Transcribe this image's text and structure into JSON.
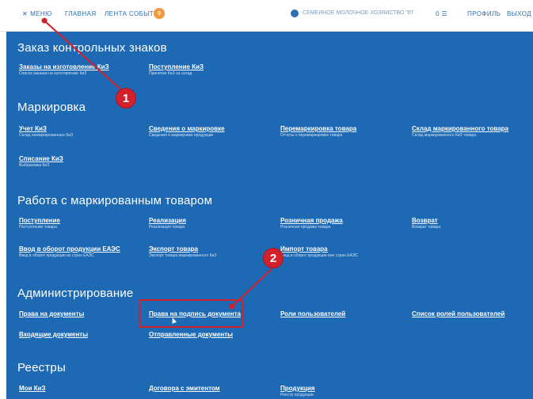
{
  "topbar": {
    "menu_icon": "close-icon",
    "menu_label": "МЕНЮ",
    "home_label": "ГЛАВНАЯ",
    "feed_label": "ЛЕНТА СОБЫТИЙ",
    "feed_badge": "0",
    "org_name": "СЕМЕЙНОЕ МОЛОЧНОЕ ХОЗЯЙСТВО \"ЕГЕНЬ\"",
    "count": "0",
    "profile_label": "ПРОФИЛЬ",
    "logout_label": "ВЫХОД"
  },
  "sections": {
    "order": {
      "title": "Заказ контрольных знаков",
      "items": [
        {
          "label": "Заказы на изготовление КиЗ",
          "sub": "Список заказов на изготовление КиЗ"
        },
        {
          "label": "Поступление КиЗ",
          "sub": "Принятие КиЗ на склад"
        }
      ]
    },
    "marking": {
      "title": "Маркировка",
      "items": [
        {
          "label": "Учет КиЗ",
          "sub": "Склад немаркированных КиЗ"
        },
        {
          "label": "Сведения о маркировке",
          "sub": "Сведения о маркировке продукции"
        },
        {
          "label": "Перемаркировка товара",
          "sub": "Отчеты о перемаркировке товара"
        },
        {
          "label": "Склад маркированного товара",
          "sub": "Склад маркированного КиЗ товара"
        },
        {
          "label": "Списание КиЗ",
          "sub": "Выбраковка КиЗ"
        }
      ]
    },
    "goods": {
      "title": "Работа с маркированным товаром",
      "items": [
        {
          "label": "Поступление",
          "sub": "Поступление товара"
        },
        {
          "label": "Реализация",
          "sub": "Реализация товара"
        },
        {
          "label": "Розничная продажа",
          "sub": "Розничная продажа товара"
        },
        {
          "label": "Возврат",
          "sub": "Возврат товара"
        },
        {
          "label": "Ввод в оборот продукции ЕАЭС",
          "sub": "Ввод в оборот продукции из стран ЕАЭС"
        },
        {
          "label": "Экспорт товара",
          "sub": "Экспорт товара маркированного КиЗ"
        },
        {
          "label": "Импорт товара",
          "sub": "Ввод в оборот продукции вне стран ЕАЭС"
        }
      ]
    },
    "admin": {
      "title": "Администрирование",
      "items": [
        {
          "label": "Права на документы"
        },
        {
          "label": "Права на подпись документа"
        },
        {
          "label": "Роли пользователей"
        },
        {
          "label": "Список ролей пользователей"
        },
        {
          "label": "Входящие документы"
        },
        {
          "label": "Отправленные документы"
        }
      ]
    },
    "registers": {
      "title": "Реестры",
      "items": [
        {
          "label": "Мои КиЗ"
        },
        {
          "label": "Договора с эмитентом"
        },
        {
          "label": "Продукция",
          "sub": "Реестр продукции"
        }
      ]
    }
  },
  "annotations": {
    "callout_1": "1",
    "callout_2": "2"
  },
  "colors": {
    "panel": "#1d69b4",
    "accent": "#d4202a",
    "badge": "#f29a3b"
  }
}
